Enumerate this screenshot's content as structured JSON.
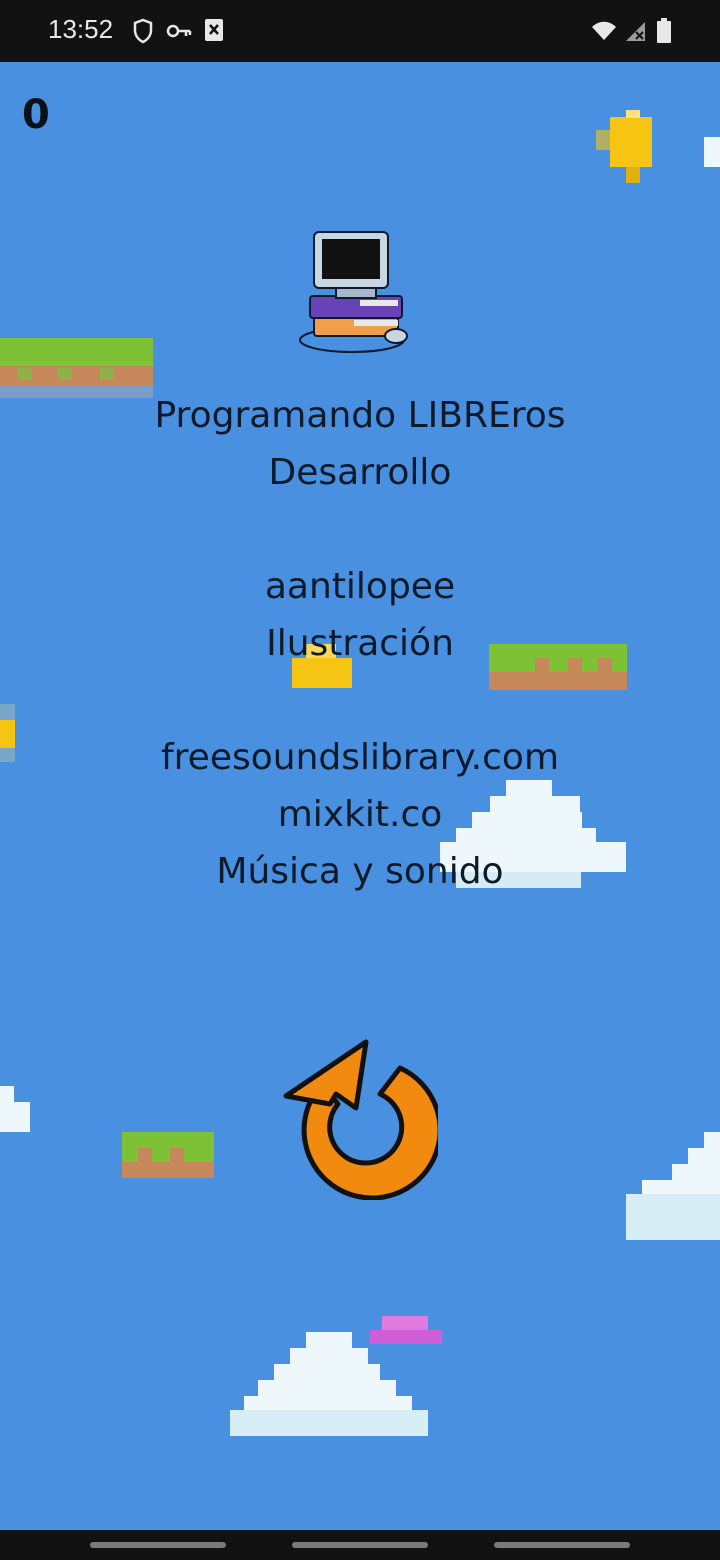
{
  "status_bar": {
    "time": "13:52",
    "left_icons": [
      "shield-icon",
      "key-icon",
      "notification-x-icon"
    ],
    "right_icons": [
      "wifi-icon",
      "signal-icon",
      "battery-icon"
    ]
  },
  "game": {
    "score": "0",
    "credits": {
      "dev_title": "Programando LIBREros",
      "dev_role": "Desarrollo",
      "illustrator": "aantilopee",
      "illustration_role": "Ilustración",
      "sound_source_1": "freesoundslibrary.com",
      "sound_source_2": "mixkit.co",
      "sound_role": "Música y sonido"
    },
    "restart_icon": "restart-arrow-icon",
    "colors": {
      "sky": "#4a90e0",
      "restart": "#f28a0f",
      "grass": "#7cc234",
      "dirt": "#c6875a",
      "coin": "#f6c514",
      "cloud": "#eef7fb"
    }
  }
}
